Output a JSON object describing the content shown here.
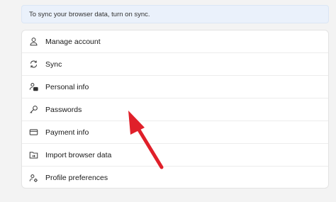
{
  "banner": {
    "text": "To sync your browser data, turn on sync."
  },
  "menu": {
    "items": [
      {
        "label": "Manage account",
        "icon": "person-icon"
      },
      {
        "label": "Sync",
        "icon": "sync-icon"
      },
      {
        "label": "Personal info",
        "icon": "personal-info-icon"
      },
      {
        "label": "Passwords",
        "icon": "key-icon"
      },
      {
        "label": "Payment info",
        "icon": "credit-card-icon"
      },
      {
        "label": "Import browser data",
        "icon": "import-icon"
      },
      {
        "label": "Profile preferences",
        "icon": "profile-preferences-icon"
      }
    ]
  },
  "annotation": {
    "arrow_color": "#e0202a"
  }
}
